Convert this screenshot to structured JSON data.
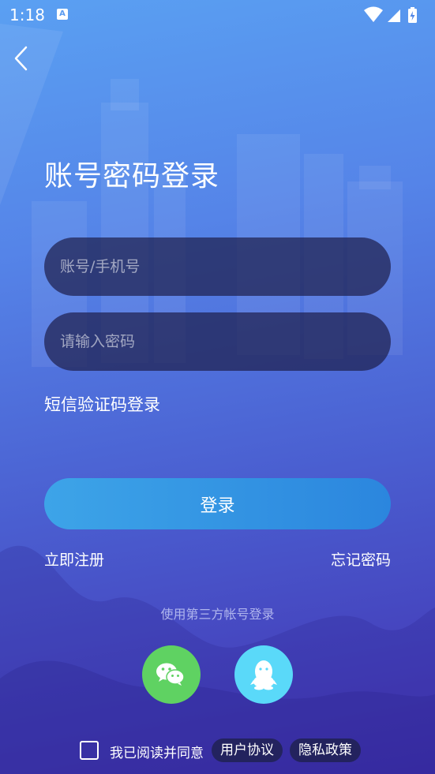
{
  "status_bar": {
    "time": "1:18",
    "notification_icon": "a-badge-icon",
    "icons": [
      "wifi-icon",
      "signal-icon",
      "battery-charging-icon"
    ]
  },
  "nav": {
    "back_icon": "chevron-left-icon"
  },
  "title": "账号密码登录",
  "form": {
    "account_placeholder": "账号/手机号",
    "password_placeholder": "请输入密码",
    "sms_login_label": "短信验证码登录",
    "login_button_label": "登录"
  },
  "links": {
    "register_label": "立即注册",
    "forgot_label": "忘记密码"
  },
  "third_party": {
    "heading": "使用第三方帐号登录",
    "providers": [
      "wechat-icon",
      "qq-icon"
    ]
  },
  "agreement": {
    "text": "我已阅读并同意",
    "user_agreement_label": "用户协议",
    "privacy_policy_label": "隐私政策",
    "checked": false
  },
  "colors": {
    "gradient_top": "#5aa0f2",
    "gradient_bottom": "#4230b0",
    "field_bg": "#1e204e",
    "login_button": "#2b86de",
    "wechat": "#5fd262",
    "qq": "#5ad9f9"
  }
}
